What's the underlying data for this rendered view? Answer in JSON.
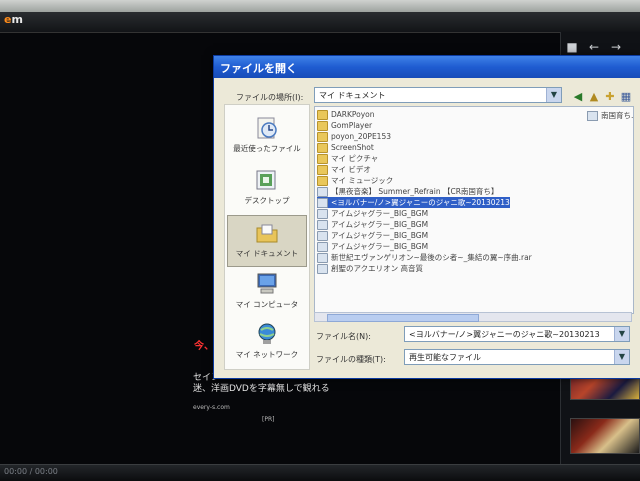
{
  "app": {
    "logo_prefix": "e",
    "logo_suffix": "m",
    "red_text": "今、",
    "bg_lines": [
      "セイン",
      "迷、洋画DVDを字幕無しで観れる",
      "every-s.com",
      "[PR]"
    ],
    "bottom_status": "00:00 / 00:00"
  },
  "dialog": {
    "title": "ファイルを開く",
    "look_in_label": "ファイルの場所(I):",
    "look_in_value": "マイ ドキュメント",
    "places": [
      {
        "label": "最近使ったファイル",
        "icon": "recent-icon"
      },
      {
        "label": "デスクトップ",
        "icon": "desktop-icon"
      },
      {
        "label": "マイ ドキュメント",
        "icon": "my-documents-icon"
      },
      {
        "label": "マイ コンピュータ",
        "icon": "my-computer-icon"
      },
      {
        "label": "マイ ネットワーク",
        "icon": "network-icon"
      }
    ],
    "files": [
      {
        "name": "DARKPoyon",
        "type": "folder"
      },
      {
        "name": "GomPlayer",
        "type": "folder"
      },
      {
        "name": "poyon_20PE153",
        "type": "folder"
      },
      {
        "name": "ScreenShot",
        "type": "folder"
      },
      {
        "name": "マイ ピクチャ",
        "type": "folder"
      },
      {
        "name": "マイ ビデオ",
        "type": "folder"
      },
      {
        "name": "マイ ミュージック",
        "type": "folder"
      },
      {
        "name": "【黒夜音楽】 Summer_Refrain 【CR南国育ち】",
        "type": "media"
      },
      {
        "name": "<ヨルバナー/ノ>翼ジャニーのジャニ歌~20130213",
        "type": "media",
        "selected": true
      },
      {
        "name": "アイムジャグラー_BIG_BGM",
        "type": "media"
      },
      {
        "name": "アイムジャグラー_BIG_BGM",
        "type": "media"
      },
      {
        "name": "アイムジャグラー_BIG_BGM",
        "type": "media"
      },
      {
        "name": "アイムジャグラー_BIG_BGM",
        "type": "media"
      },
      {
        "name": "新世紀エヴァンゲリオン~最後のシ者~_集結の翼~序曲.rar",
        "type": "media"
      },
      {
        "name": "創聖のアクエリオン 高音質",
        "type": "media"
      }
    ],
    "right_item": "南国育ち.",
    "filename_label": "ファイル名(N):",
    "filename_value": "<ヨルバナー/ノ>翼ジャニーのジャニ歌~20130213",
    "filetype_label": "ファイルの種類(T):",
    "filetype_value": "再生可能なファイル"
  },
  "colors": {
    "selection": "#2f5fc7",
    "titlebar": "#1f5cd1"
  }
}
